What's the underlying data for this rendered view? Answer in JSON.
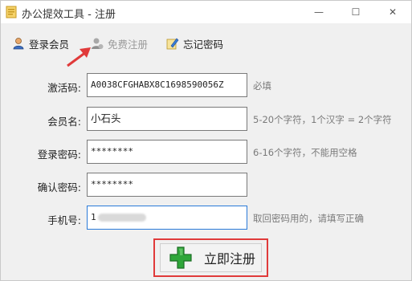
{
  "window": {
    "title": "办公提效工具 - 注册",
    "controls": {
      "minimize": "—",
      "maximize": "☐",
      "close": "✕"
    }
  },
  "toolbar": {
    "items": [
      {
        "label": "登录会员",
        "icon": "user-icon",
        "enabled": true
      },
      {
        "label": "免费注册",
        "icon": "user-add-icon",
        "enabled": false
      },
      {
        "label": "忘记密码",
        "icon": "edit-icon",
        "enabled": true
      }
    ]
  },
  "form": {
    "fields": [
      {
        "label": "激活码:",
        "value": "A0038CFGHABX8C1698590056Z",
        "hint": "必填"
      },
      {
        "label": "会员名:",
        "value": "小石头",
        "hint": "5-20个字符，1个汉字 = 2个字符"
      },
      {
        "label": "登录密码:",
        "value": "********",
        "hint": "6-16个字符，不能用空格"
      },
      {
        "label": "确认密码:",
        "value": "********",
        "hint": ""
      },
      {
        "label": "手机号:",
        "value": "1",
        "hint": "取回密码用的，请填写正确"
      }
    ]
  },
  "submit": {
    "label": "立即注册",
    "icon": "plus-icon"
  },
  "colors": {
    "highlight_border": "#e03a3a",
    "plus_green": "#2fa63a",
    "arrow_red": "#e03a3a",
    "focus_border": "#2a7ad8"
  }
}
